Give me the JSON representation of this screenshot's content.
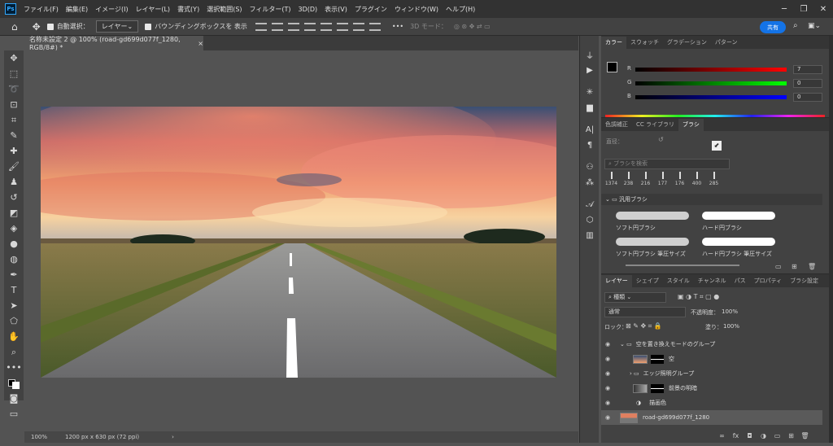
{
  "menu": [
    "ファイル(F)",
    "編集(E)",
    "イメージ(I)",
    "レイヤー(L)",
    "書式(Y)",
    "選択範囲(S)",
    "フィルター(T)",
    "3D(D)",
    "表示(V)",
    "プラグイン",
    "ウィンドウ(W)",
    "ヘルプ(H)"
  ],
  "app_logo": "Ps",
  "options": {
    "auto_select": "自動選択：",
    "layer_dd": "レイヤー",
    "bbox": "バウンディングボックスを 表示",
    "mode3d": "3D モード：",
    "share": "共有"
  },
  "document": {
    "tab_title": "名称未設定 2 @ 100% (road-gd699d077f_1280, RGB/8#) *",
    "close": "×"
  },
  "status": {
    "zoom": "100%",
    "size": "1200 px x 630 px (72 ppi)"
  },
  "color_panel": {
    "tabs": [
      "カラー",
      "スウォッチ",
      "グラデーション",
      "パターン"
    ],
    "r_label": "R",
    "g_label": "G",
    "b_label": "B",
    "r": "7",
    "g": "0",
    "b": "0"
  },
  "brush_panel": {
    "tabs": [
      "色調補正",
      "CC ライブラリ",
      "ブラシ"
    ],
    "size_label": "直径：",
    "search_placeholder": "ブラシを検索",
    "sizes": [
      "1374",
      "238",
      "216",
      "177",
      "176",
      "400",
      "285"
    ],
    "group": "汎用ブラシ",
    "brushes": [
      "ソフト円ブラシ",
      "ハード円ブラシ",
      "ソフト円ブラシ 筆圧サイズ",
      "ハード円ブラシ 筆圧サイズ"
    ]
  },
  "layers_panel": {
    "tabs": [
      "レイヤー",
      "シェイプ",
      "スタイル",
      "チャンネル",
      "パス",
      "プロパティ",
      "ブラシ設定"
    ],
    "filter": "種類",
    "blend": "通常",
    "opacity_label": "不透明度：",
    "opacity": "100%",
    "lock_label": "ロック：",
    "fill_label": "塗り：",
    "fill": "100%",
    "layers": [
      {
        "name": "空を置き換えモードのグループ",
        "type": "group"
      },
      {
        "name": "空",
        "type": "layer"
      },
      {
        "name": "エッジ照明グループ",
        "type": "group"
      },
      {
        "name": "前景の明暗",
        "type": "layer"
      },
      {
        "name": "描画色",
        "type": "adjust"
      },
      {
        "name": "road-gd699d077f_1280",
        "type": "layer"
      }
    ]
  },
  "colors": {
    "accent": "#1473e6",
    "bg": "#535353",
    "panel": "#424242"
  }
}
